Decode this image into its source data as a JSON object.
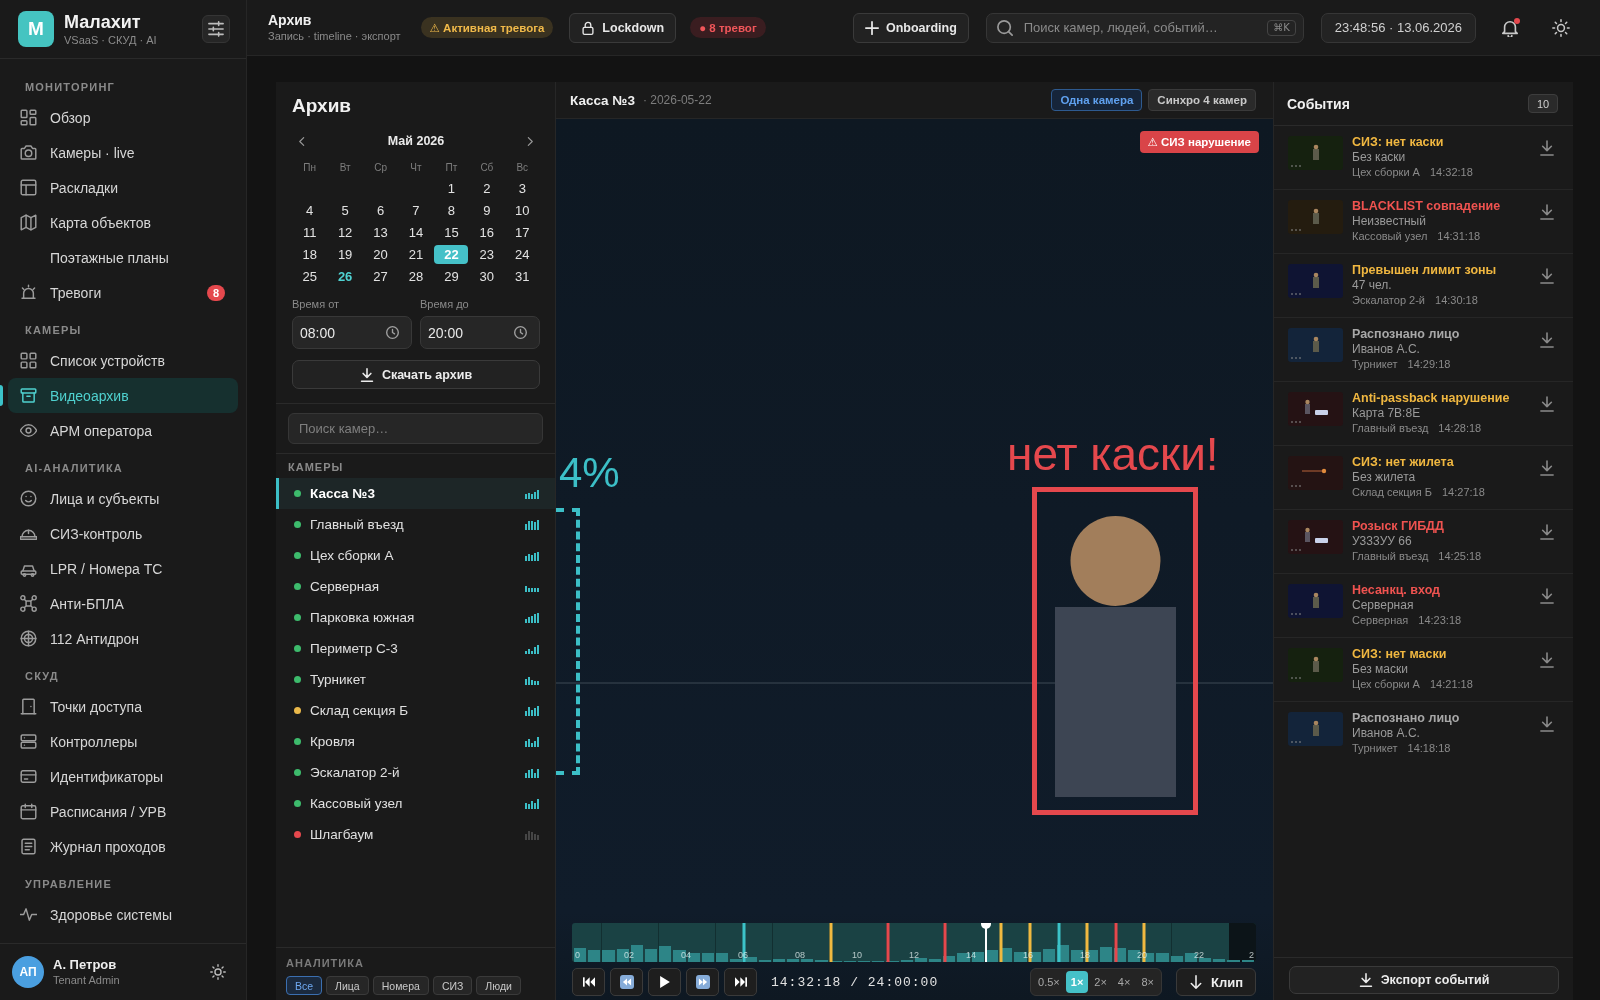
{
  "sidebar": {
    "logo": {
      "letter": "M",
      "title": "Малахит",
      "subtitle": "VSaaS · СКУД · AI"
    },
    "sections": [
      {
        "label": "МОНИТОРИНГ",
        "items": [
          {
            "label": "Обзор",
            "selected": false
          },
          {
            "label": "Камеры · live",
            "selected": false
          },
          {
            "label": "Раскладки",
            "selected": false
          },
          {
            "label": "Карта объектов",
            "selected": false
          },
          {
            "label": "Поэтажные планы",
            "selected": false
          },
          {
            "label": "Тревоги",
            "selected": false,
            "badge": "8"
          }
        ]
      },
      {
        "label": "КАМЕРЫ",
        "items": [
          {
            "label": "Список устройств",
            "selected": false
          },
          {
            "label": "Видеоархив",
            "selected": true
          },
          {
            "label": "АРМ оператора",
            "selected": false
          }
        ]
      },
      {
        "label": "AI-АНАЛИТИКА",
        "items": [
          {
            "label": "Лица и субъекты",
            "selected": false
          },
          {
            "label": "СИЗ-контроль",
            "selected": false
          },
          {
            "label": "LPR / Номера ТС",
            "selected": false
          },
          {
            "label": "Анти-БПЛА",
            "selected": false
          },
          {
            "label": "112 Антидрон",
            "selected": false
          }
        ]
      },
      {
        "label": "СКУД",
        "items": [
          {
            "label": "Точки доступа",
            "selected": false
          },
          {
            "label": "Контроллеры",
            "selected": false
          },
          {
            "label": "Идентификаторы",
            "selected": false
          },
          {
            "label": "Расписания / УРВ",
            "selected": false
          },
          {
            "label": "Журнал проходов",
            "selected": false
          }
        ]
      },
      {
        "label": "УПРАВЛЕНИЕ",
        "items": [
          {
            "label": "Здоровье системы",
            "selected": false
          }
        ]
      }
    ],
    "user": {
      "initials": "АП",
      "name": "А. Петров",
      "role": "Tenant Admin"
    }
  },
  "topbar": {
    "title": "Архив",
    "subtitle": "Запись · timeline · экспорт",
    "alert": "⚠ Активная тревога",
    "lockdown_button": "Lockdown",
    "alarms": "● 8 тревог",
    "onboarding_button": "Onboarding",
    "search": {
      "placeholder": "Поиск камер, людей, событий…",
      "shortcut": "⌘K"
    },
    "clock": "23:48:56 · 13.06.2026",
    "notifications": {
      "unread": true
    }
  },
  "archive": {
    "title": "Архив",
    "calendar": {
      "month": "Май 2026",
      "weekdays": [
        "Пн",
        "Вт",
        "Ср",
        "Чт",
        "Пт",
        "Сб",
        "Вс"
      ],
      "weeks": [
        [
          {
            "label": "1",
            "selected": false,
            "today": false
          },
          {
            "label": "2",
            "selected": false,
            "today": false
          },
          {
            "label": "3",
            "selected": false,
            "today": false
          }
        ],
        [
          {
            "label": "4",
            "selected": false,
            "today": false
          },
          {
            "label": "5",
            "selected": false,
            "today": false
          },
          {
            "label": "6",
            "selected": false,
            "today": false
          },
          {
            "label": "7",
            "selected": false,
            "today": false
          },
          {
            "label": "8",
            "selected": false,
            "today": false
          },
          {
            "label": "9",
            "selected": false,
            "today": false
          },
          {
            "label": "10",
            "selected": false,
            "today": false
          }
        ],
        [
          {
            "label": "11",
            "selected": false,
            "today": false
          },
          {
            "label": "12",
            "selected": false,
            "today": false
          },
          {
            "label": "13",
            "selected": false,
            "today": false
          },
          {
            "label": "14",
            "selected": false,
            "today": false
          },
          {
            "label": "15",
            "selected": false,
            "today": false
          },
          {
            "label": "16",
            "selected": false,
            "today": false
          },
          {
            "label": "17",
            "selected": false,
            "today": false
          }
        ],
        [
          {
            "label": "18",
            "selected": false,
            "today": false
          },
          {
            "label": "19",
            "selected": false,
            "today": false
          },
          {
            "label": "20",
            "selected": false,
            "today": false
          },
          {
            "label": "21",
            "selected": false,
            "today": false
          },
          {
            "label": "22",
            "selected": true,
            "today": false
          },
          {
            "label": "23",
            "selected": false,
            "today": false
          },
          {
            "label": "24",
            "selected": false,
            "today": false
          }
        ],
        [
          {
            "label": "25",
            "selected": false,
            "today": false
          },
          {
            "label": "26",
            "selected": false,
            "today": true
          },
          {
            "label": "27",
            "selected": false,
            "today": false
          },
          {
            "label": "28",
            "selected": false,
            "today": false
          },
          {
            "label": "29",
            "selected": false,
            "today": false
          },
          {
            "label": "30",
            "selected": false,
            "today": false
          },
          {
            "label": "31",
            "selected": false,
            "today": false
          }
        ]
      ]
    },
    "time_from": {
      "label": "Время от",
      "value": "08:00"
    },
    "time_to": {
      "label": "Время до",
      "value": "20:00"
    },
    "download_button": "Скачать архив",
    "camera_search": {
      "placeholder": "Поиск камер…"
    },
    "cameras": {
      "heading": "КАМЕРЫ",
      "items": [
        {
          "name": "Касса №3",
          "color": "#3dbb6c",
          "online": true,
          "selected": true
        },
        {
          "name": "Главный въезд",
          "color": "#3dbb6c",
          "online": true,
          "selected": false
        },
        {
          "name": "Цех сборки А",
          "color": "#3dbb6c",
          "online": true,
          "selected": false
        },
        {
          "name": "Серверная",
          "color": "#3dbb6c",
          "online": true,
          "selected": false
        },
        {
          "name": "Парковка южная",
          "color": "#3dbb6c",
          "online": true,
          "selected": false
        },
        {
          "name": "Периметр С-3",
          "color": "#3dbb6c",
          "online": true,
          "selected": false
        },
        {
          "name": "Турникет",
          "color": "#3dbb6c",
          "online": true,
          "selected": false
        },
        {
          "name": "Склад секция Б",
          "color": "#eab94a",
          "online": true,
          "selected": false
        },
        {
          "name": "Кровля",
          "color": "#3dbb6c",
          "online": true,
          "selected": false
        },
        {
          "name": "Эскалатор 2-й",
          "color": "#3dbb6c",
          "online": true,
          "selected": false
        },
        {
          "name": "Кассовый узел",
          "color": "#3dbb6c",
          "online": true,
          "selected": false
        },
        {
          "name": "Шлагбаум",
          "color": "#e5484d",
          "online": false,
          "selected": false
        }
      ]
    },
    "analytics": {
      "heading": "АНАЛИТИКА",
      "filters": [
        {
          "label": "Все",
          "selected": true
        },
        {
          "label": "Лица",
          "selected": false
        },
        {
          "label": "Номера",
          "selected": false
        },
        {
          "label": "СИЗ",
          "selected": false
        },
        {
          "label": "Люди",
          "selected": false
        }
      ]
    }
  },
  "player": {
    "camera": "Касса №3",
    "date": "· 2026-05-22",
    "view_modes": [
      {
        "label": "Одна камера",
        "selected": true
      },
      {
        "label": "Синхро 4 камер",
        "selected": false
      }
    ],
    "alert_badge": "⚠ СИЗ нарушение",
    "violation_label": "нет каски!",
    "confidence_label": "4%",
    "timeline": {
      "hour_labels": [
        "0",
        "02",
        "04",
        "06",
        "08",
        "10",
        "12",
        "14",
        "16",
        "18",
        "20",
        "22",
        "2"
      ],
      "level": 0.605
    },
    "transport": {
      "time": "14:32:18 / 24:00:00",
      "speeds": [
        {
          "label": "0.5×",
          "selected": false
        },
        {
          "label": "1×",
          "selected": true
        },
        {
          "label": "2×",
          "selected": false
        },
        {
          "label": "4×",
          "selected": false
        },
        {
          "label": "8×",
          "selected": false
        }
      ],
      "clip_button": "Клип"
    }
  },
  "events": {
    "title": "События",
    "count": "10",
    "items": [
      {
        "title": "СИЗ: нет каски",
        "color": "#f0b740",
        "subject": "Без каски",
        "camera": "Цех сборки А",
        "time": "14:32:18",
        "thumbnail": {
          "kind": "person",
          "color": "#15210f"
        }
      },
      {
        "title": "BLACKLIST совпадение",
        "color": "#ef5350",
        "subject": "Неизвестный",
        "camera": "Кассовый узел",
        "time": "14:31:18",
        "thumbnail": {
          "kind": "person",
          "color": "#241c0f"
        }
      },
      {
        "title": "Превышен лимит зоны",
        "color": "#f0b740",
        "subject": "47 чел.",
        "camera": "Эскалатор 2-й",
        "time": "14:30:18",
        "thumbnail": {
          "kind": "person",
          "color": "#0f1433"
        }
      },
      {
        "title": "Распознано лицо",
        "color": "#a8a8a8",
        "subject": "Иванов А.С.",
        "camera": "Турникет",
        "time": "14:29:18",
        "thumbnail": {
          "kind": "person",
          "color": "#13243a"
        }
      },
      {
        "title": "Anti-passback нарушение",
        "color": "#f0b740",
        "subject": "Карта 7B:8E",
        "camera": "Главный въезд",
        "time": "14:28:18",
        "thumbnail": {
          "kind": "plate",
          "color": "#251214"
        }
      },
      {
        "title": "СИЗ: нет жилета",
        "color": "#f0b740",
        "subject": "Без жилета",
        "camera": "Склад секция Б",
        "time": "14:27:18",
        "thumbnail": {
          "kind": "tripwire",
          "color": "#241313"
        }
      },
      {
        "title": "Розыск ГИБДД",
        "color": "#ef5350",
        "subject": "У333УУ 66",
        "camera": "Главный въезд",
        "time": "14:25:18",
        "thumbnail": {
          "kind": "plate",
          "color": "#251214"
        }
      },
      {
        "title": "Несанкц. вход",
        "color": "#ef5350",
        "subject": "Серверная",
        "camera": "Серверная",
        "time": "14:23:18",
        "thumbnail": {
          "kind": "person",
          "color": "#0f1433"
        }
      },
      {
        "title": "СИЗ: нет маски",
        "color": "#f0b740",
        "subject": "Без маски",
        "camera": "Цех сборки А",
        "time": "14:21:18",
        "thumbnail": {
          "kind": "person",
          "color": "#15210f"
        }
      },
      {
        "title": "Распознано лицо",
        "color": "#a8a8a8",
        "subject": "Иванов А.С.",
        "camera": "Турникет",
        "time": "14:18:18",
        "thumbnail": {
          "kind": "person",
          "color": "#13243a"
        }
      }
    ],
    "export_button": "Экспорт событий"
  }
}
